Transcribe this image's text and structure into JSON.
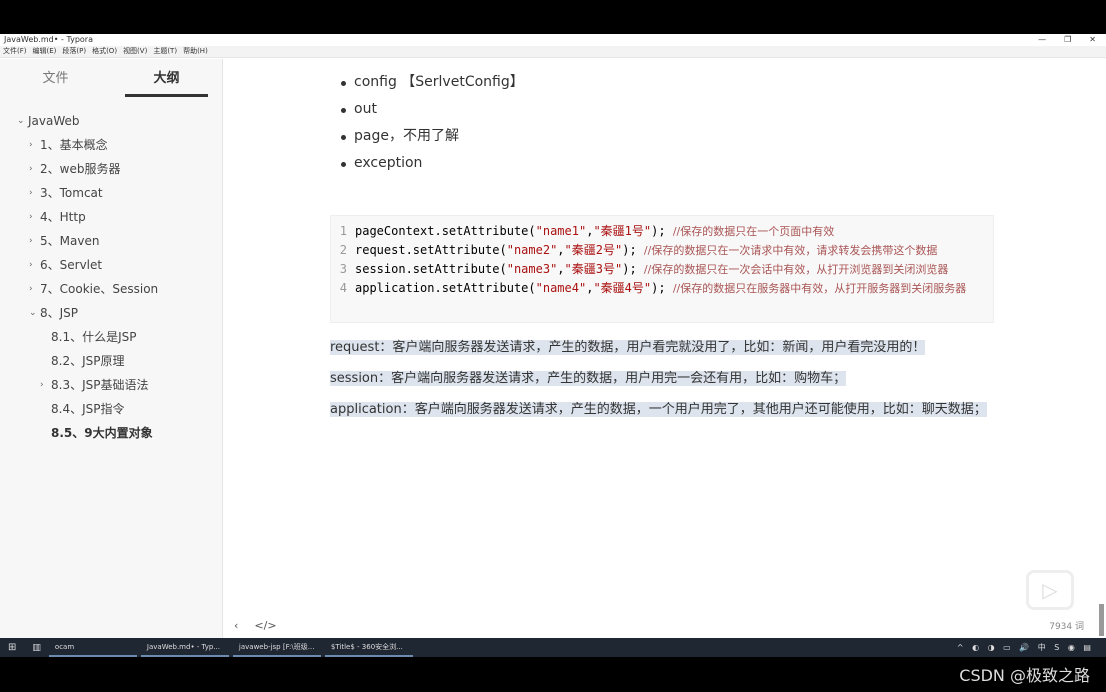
{
  "window": {
    "title": "JavaWeb.md• - Typora",
    "controls": [
      "—",
      "❐",
      "✕"
    ]
  },
  "menu": [
    "文件(F)",
    "编辑(E)",
    "段落(P)",
    "格式(O)",
    "视图(V)",
    "主题(T)",
    "帮助(H)"
  ],
  "sidebar": {
    "tabs": [
      "文件",
      "大纲"
    ],
    "active_tab": "大纲",
    "outline": [
      {
        "label": "JavaWeb",
        "level": 0,
        "chevron": "down"
      },
      {
        "label": "1、基本概念",
        "level": 1,
        "chevron": "right"
      },
      {
        "label": "2、web服务器",
        "level": 1,
        "chevron": "right"
      },
      {
        "label": "3、Tomcat",
        "level": 1,
        "chevron": "right"
      },
      {
        "label": "4、Http",
        "level": 1,
        "chevron": "right"
      },
      {
        "label": "5、Maven",
        "level": 1,
        "chevron": "right"
      },
      {
        "label": "6、Servlet",
        "level": 1,
        "chevron": "right"
      },
      {
        "label": "7、Cookie、Session",
        "level": 1,
        "chevron": "right"
      },
      {
        "label": "8、JSP",
        "level": 1,
        "chevron": "down"
      },
      {
        "label": "8.1、什么是JSP",
        "level": 2,
        "chevron": ""
      },
      {
        "label": "8.2、JSP原理",
        "level": 2,
        "chevron": ""
      },
      {
        "label": "8.3、JSP基础语法",
        "level": 2,
        "chevron": "right"
      },
      {
        "label": "8.4、JSP指令",
        "level": 2,
        "chevron": ""
      },
      {
        "label": "8.5、9大内置对象",
        "level": 2,
        "chevron": "",
        "current": true
      }
    ]
  },
  "content": {
    "bullets": [
      "config 【SerlvetConfig】",
      "out",
      "page，不用了解",
      "exception"
    ],
    "code": [
      {
        "n": "1",
        "pre": "pageContext.setAttribute(",
        "a": "\"name1\"",
        "b": "\"秦疆1号\"",
        "post": "); ",
        "comment": "//保存的数据只在一个页面中有效"
      },
      {
        "n": "2",
        "pre": "request.setAttribute(",
        "a": "\"name2\"",
        "b": "\"秦疆2号\"",
        "post": "); ",
        "comment": "//保存的数据只在一次请求中有效，请求转发会携带这个数据"
      },
      {
        "n": "3",
        "pre": "session.setAttribute(",
        "a": "\"name3\"",
        "b": "\"秦疆3号\"",
        "post": "); ",
        "comment": "//保存的数据只在一次会话中有效，从打开浏览器到关闭浏览器"
      },
      {
        "n": "4",
        "pre": "application.setAttribute(",
        "a": "\"name4\"",
        "b": "\"秦疆4号\"",
        "post": ");  ",
        "comment": "//保存的数据只在服务器中有效，从打开服务器到关闭服务器"
      }
    ],
    "paragraphs": [
      "request：客户端向服务器发送请求，产生的数据，用户看完就没用了，比如：新闻，用户看完没用的！",
      "session：客户端向服务器发送请求，产生的数据，用户用完一会还有用，比如：购物车；",
      "application：客户端向服务器发送请求，产生的数据，一个用户用完了，其他用户还可能使用，比如：聊天数据；"
    ],
    "word_count": "7934 词"
  },
  "taskbar": {
    "items": [
      "ocam",
      "JavaWeb.md• - Typ...",
      "javaweb-jsp [F:\\班级...",
      "$Title$ - 360安全浏..."
    ],
    "tray": "^ ◐ ◑ ▭ 🔊 中 S ◉ ▤"
  },
  "watermark": "CSDN @极致之路"
}
